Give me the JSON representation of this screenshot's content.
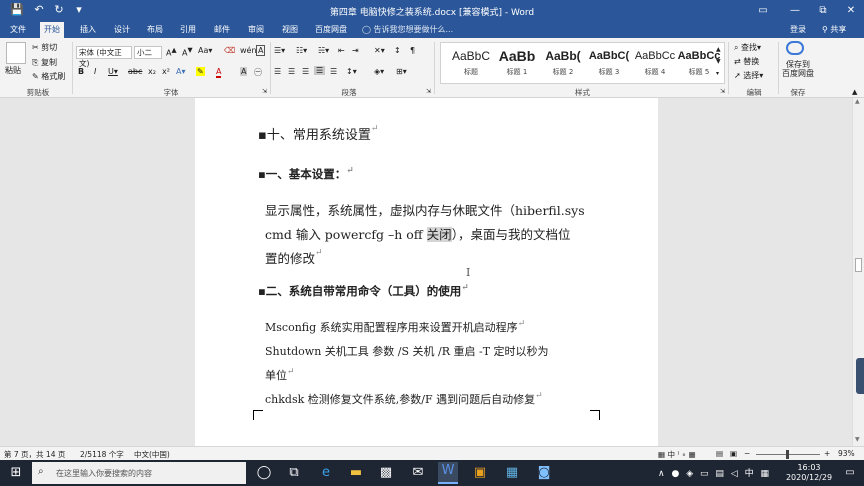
{
  "window": {
    "title": "第四章 电脑快修之装系统.docx [兼容模式] - Word",
    "controls": [
      "▭",
      "—",
      "⧉",
      "✕"
    ]
  },
  "tabs": [
    "文件",
    "开始",
    "插入",
    "设计",
    "布局",
    "引用",
    "邮件",
    "审阅",
    "视图",
    "百度网盘"
  ],
  "tell_me": "告诉我您想要做什么...",
  "account": {
    "login": "登录",
    "share": "共享"
  },
  "clipboard": {
    "paste": "粘贴",
    "cut": "剪切",
    "copy": "复制",
    "format_painter": "格式刷",
    "label": "剪贴板"
  },
  "font": {
    "name": "宋体 (中文正文)",
    "size": "小二",
    "label": "字体"
  },
  "paragraph": {
    "label": "段落"
  },
  "styles": {
    "label": "样式",
    "items": [
      {
        "preview": "AaBbC",
        "name": "标题"
      },
      {
        "preview": "AaBb",
        "name": "标题 1"
      },
      {
        "preview": "AaBb(",
        "name": "标题 2"
      },
      {
        "preview": "AaBbC(",
        "name": "标题 3"
      },
      {
        "preview": "AaBbCc",
        "name": "标题 4"
      },
      {
        "preview": "AaBbCc",
        "name": "标题 5"
      }
    ]
  },
  "editing": {
    "find": "查找",
    "replace": "替换",
    "select": "选择",
    "label": "编辑"
  },
  "save": {
    "line1": "保存到",
    "line2": "百度网盘",
    "label": "保存"
  },
  "document": {
    "heading_main": "十、常用系统设置",
    "section1": "一、基本设置：",
    "para1_line1": "显示属性，系统属性，虚拟内存与休眠文件（hiberfil.sys",
    "para1_line2a": "cmd  输入  powercfg –h off ",
    "para1_line2b": "关闭",
    "para1_line2c": "），桌面与我的文档位",
    "para1_line3": "置的修改",
    "section2": "二、系统自带常用命令（工具）的使用",
    "cmd1": "Msconfig 系统实用配置程序用来设置开机启动程序 ",
    "cmd2_line1": "Shutdown  关机工具    参数  /S  关机    /R  重启    -T  定时以秒为",
    "cmd2_line2": "单位",
    "cmd3": "chkdsk  检测修复文件系统,参数/F  遇到问题后自动修复"
  },
  "status": {
    "page": "第 7 页，共 14 页",
    "words": "2/5118 个字",
    "lang": "中文(中国)",
    "zoom": "93%",
    "ime": "中"
  },
  "taskbar": {
    "search_placeholder": "在这里输入你要搜索的内容",
    "time": "16:03",
    "date": "2020/12/29",
    "ime": "中"
  }
}
